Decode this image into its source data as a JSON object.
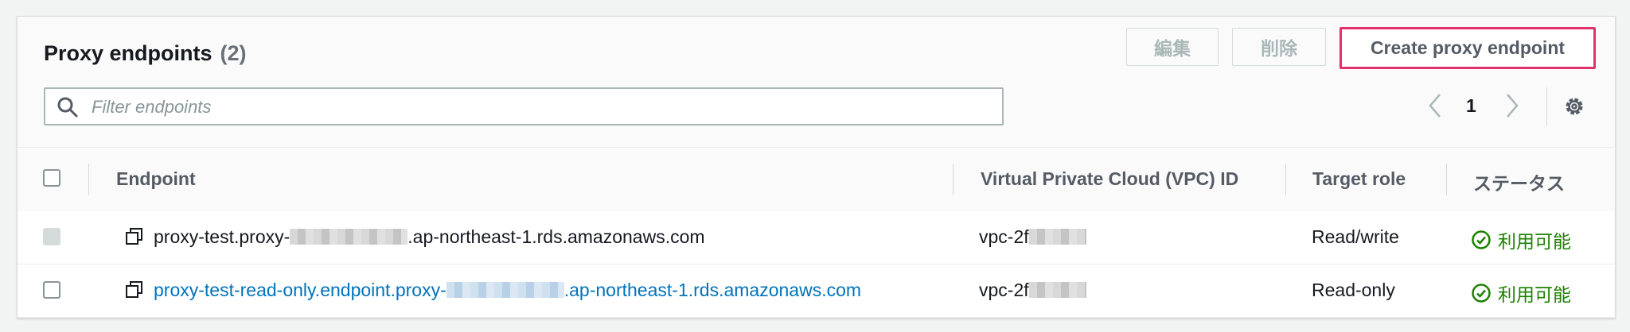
{
  "header": {
    "title": "Proxy endpoints",
    "count": "(2)"
  },
  "buttons": {
    "edit": "編集",
    "delete": "削除",
    "create": "Create proxy endpoint"
  },
  "filter": {
    "placeholder": "Filter endpoints",
    "value": ""
  },
  "pagination": {
    "current_page": "1"
  },
  "table": {
    "columns": [
      "Endpoint",
      "Virtual Private Cloud (VPC) ID",
      "Target role",
      "ステータス"
    ],
    "rows": [
      {
        "endpoint_prefix": "proxy-test.proxy-",
        "endpoint_suffix": ".ap-northeast-1.rds.amazonaws.com",
        "vpc_prefix": "vpc-2f",
        "target_role": "Read/write",
        "status": "利用可能",
        "selectable": false,
        "link": false
      },
      {
        "endpoint_prefix": "proxy-test-read-only.endpoint.proxy-",
        "endpoint_suffix": ".ap-northeast-1.rds.amazonaws.com",
        "vpc_prefix": "vpc-2f",
        "target_role": "Read-only",
        "status": "利用可能",
        "selectable": true,
        "link": true
      }
    ]
  },
  "colors": {
    "accent": "#e3306e",
    "link": "#0073bb",
    "status_ok": "#1d8102"
  },
  "icons": [
    "search-icon",
    "chevron-left-icon",
    "chevron-right-icon",
    "gear-icon",
    "copy-icon",
    "check-circle-icon"
  ]
}
